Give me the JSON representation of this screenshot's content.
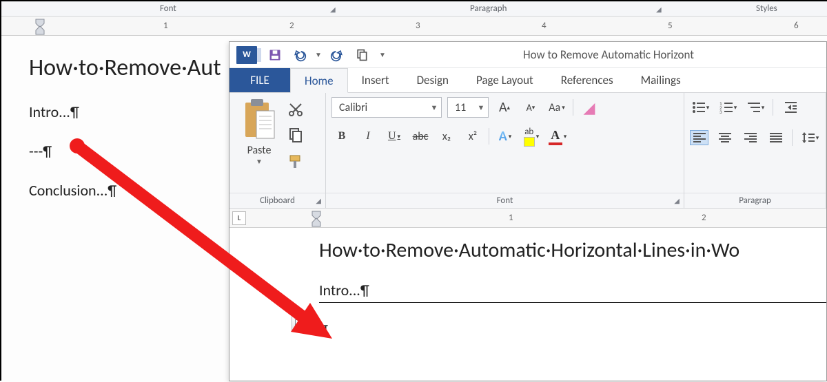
{
  "bg": {
    "groups": {
      "font": "Font",
      "paragraph": "Paragraph",
      "styles": "Styles"
    },
    "ruler": [
      "1",
      "2",
      "3",
      "4",
      "5",
      "6"
    ],
    "h1": "How·to·Remove·Aut",
    "p1": "Intro...¶",
    "p2": "---¶",
    "p3": "Conclusion...¶"
  },
  "fg": {
    "title": "How to Remove Automatic Horizont",
    "tabs": {
      "file": "FILE",
      "home": "Home",
      "insert": "Insert",
      "design": "Design",
      "pagelayout": "Page Layout",
      "references": "References",
      "mailings": "Mailings"
    },
    "groups": {
      "clipboard": "Clipboard",
      "font": "Font",
      "paragraph": "Paragrap"
    },
    "paste_label": "Paste",
    "font_name": "Calibri",
    "font_size": "11",
    "fmt": {
      "bold": "B",
      "italic": "I",
      "underline": "U",
      "strike": "abc",
      "sub": "x₂",
      "sup": "x²",
      "aa": "Aa",
      "a_big": "A",
      "a_small": "A"
    },
    "ruler": [
      "1",
      "2"
    ],
    "margin_box": "L",
    "doc": {
      "h1": "How·to·Remove·Automatic·Horizontal·Lines·in·Wo",
      "p1": "Intro...¶",
      "p2": "¶"
    }
  }
}
